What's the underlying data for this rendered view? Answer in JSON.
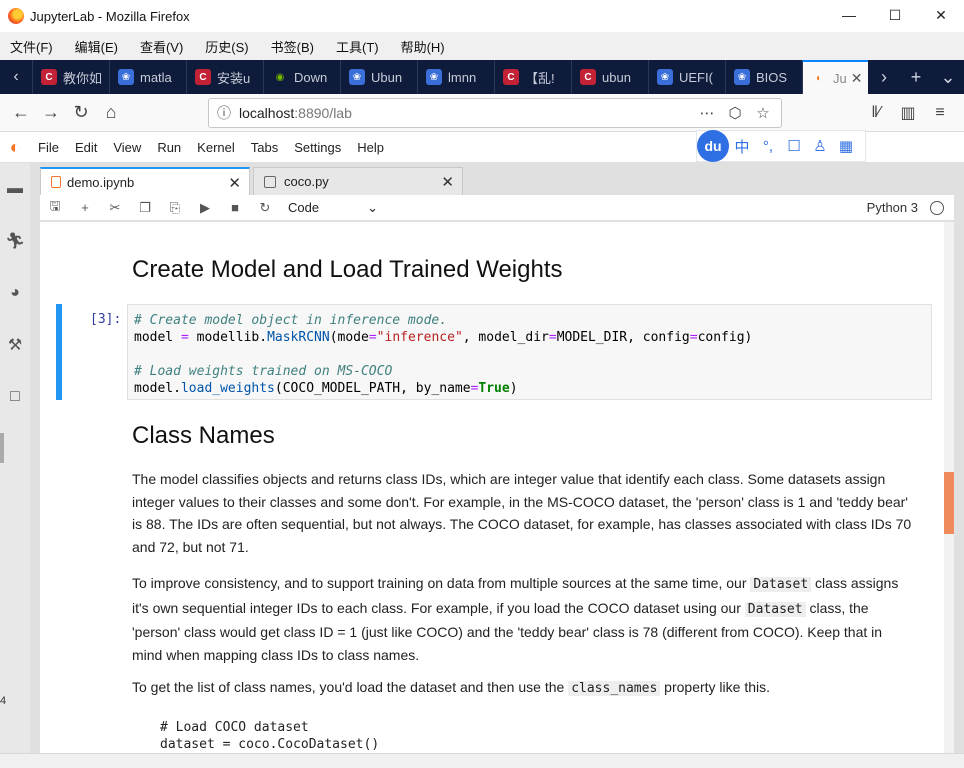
{
  "window": {
    "title": "JupyterLab - Mozilla Firefox",
    "controls": [
      "—",
      "☐",
      "✕"
    ]
  },
  "firefox_menu": [
    "文件(F)",
    "编辑(E)",
    "查看(V)",
    "历史(S)",
    "书签(B)",
    "工具(T)",
    "帮助(H)"
  ],
  "browser_tabs": [
    {
      "label": "教你如",
      "icon": "csdn-icon",
      "color": "#c32136"
    },
    {
      "label": "matla",
      "icon": "paw-icon",
      "color": "#3a6ed8"
    },
    {
      "label": "安装u",
      "icon": "csdn-icon",
      "color": "#c32136"
    },
    {
      "label": "Down",
      "icon": "nvidia-icon",
      "color": "#76b900"
    },
    {
      "label": "Ubun",
      "icon": "paw-icon",
      "color": "#3a6ed8"
    },
    {
      "label": "lmnn",
      "icon": "paw-icon",
      "color": "#3a6ed8"
    },
    {
      "label": "【乱!",
      "icon": "csdn-icon",
      "color": "#c32136"
    },
    {
      "label": "ubun",
      "icon": "csdn-icon",
      "color": "#c32136"
    },
    {
      "label": "UEFI(",
      "icon": "paw-icon",
      "color": "#3a6ed8"
    },
    {
      "label": "BIOS",
      "icon": "paw-icon",
      "color": "#3a6ed8"
    },
    {
      "label": "Ju",
      "icon": "jupyter-icon",
      "color": "#f37726",
      "active": true
    }
  ],
  "address": {
    "host": "localhost",
    "rest": ":8890/lab"
  },
  "jupyter_menu": [
    "File",
    "Edit",
    "View",
    "Run",
    "Kernel",
    "Tabs",
    "Settings",
    "Help"
  ],
  "ime": {
    "logo": "du",
    "items": [
      "中",
      "°,",
      "☐",
      "♙",
      "▦"
    ]
  },
  "doc_tabs": [
    {
      "label": "demo.ipynb",
      "active": true
    },
    {
      "label": "coco.py",
      "active": false
    }
  ],
  "toolbar": {
    "cell_type": "Code",
    "kernel": "Python 3"
  },
  "notebook": {
    "heading1": "Create Model and Load Trained Weights",
    "cell_prompt": "[3]:",
    "code": {
      "line1_comment": "# Create model object in inference mode.",
      "line2": {
        "a": "model ",
        "op1": "=",
        "b": " modellib.",
        "c": "MaskRCNN",
        "d": "(mode",
        "op2": "=",
        "e": "\"inference\"",
        "f": ", model_dir",
        "op3": "=",
        "g": "MODEL_DIR, config",
        "op4": "=",
        "h": "config)"
      },
      "line4_comment": "# Load weights trained on MS-COCO",
      "line5": {
        "a": "model.",
        "b": "load_weights",
        "c": "(COCO_MODEL_PATH, by_name",
        "op": "=",
        "d": "True",
        "e": ")"
      }
    },
    "heading2": "Class Names",
    "para1": "The model classifies objects and returns class IDs, which are integer value that identify each class. Some datasets assign integer values to their classes and some don't. For example, in the MS-COCO dataset, the 'person' class is 1 and 'teddy bear' is 88. The IDs are often sequential, but not always. The COCO dataset, for example, has classes associated with class IDs 70 and 72, but not 71.",
    "para2": {
      "t1": "To improve consistency, and to support training on data from multiple sources at the same time, our ",
      "c1": "Dataset",
      "t2": " class assigns it's own sequential integer IDs to each class. For example, if you load the COCO dataset using our ",
      "c2": "Dataset",
      "t3": " class, the 'person' class would get class ID = 1 (just like COCO) and the 'teddy bear' class is 78 (different from COCO). Keep that in mind when mapping class IDs to class names."
    },
    "para3": {
      "t1": "To get the list of class names, you'd load the dataset and then use the ",
      "c1": "class_names",
      "t2": " property like this."
    },
    "pre_line1": "# Load COCO dataset",
    "pre_line2": "dataset = coco.CocoDataset()"
  },
  "sidebar_number": "4"
}
